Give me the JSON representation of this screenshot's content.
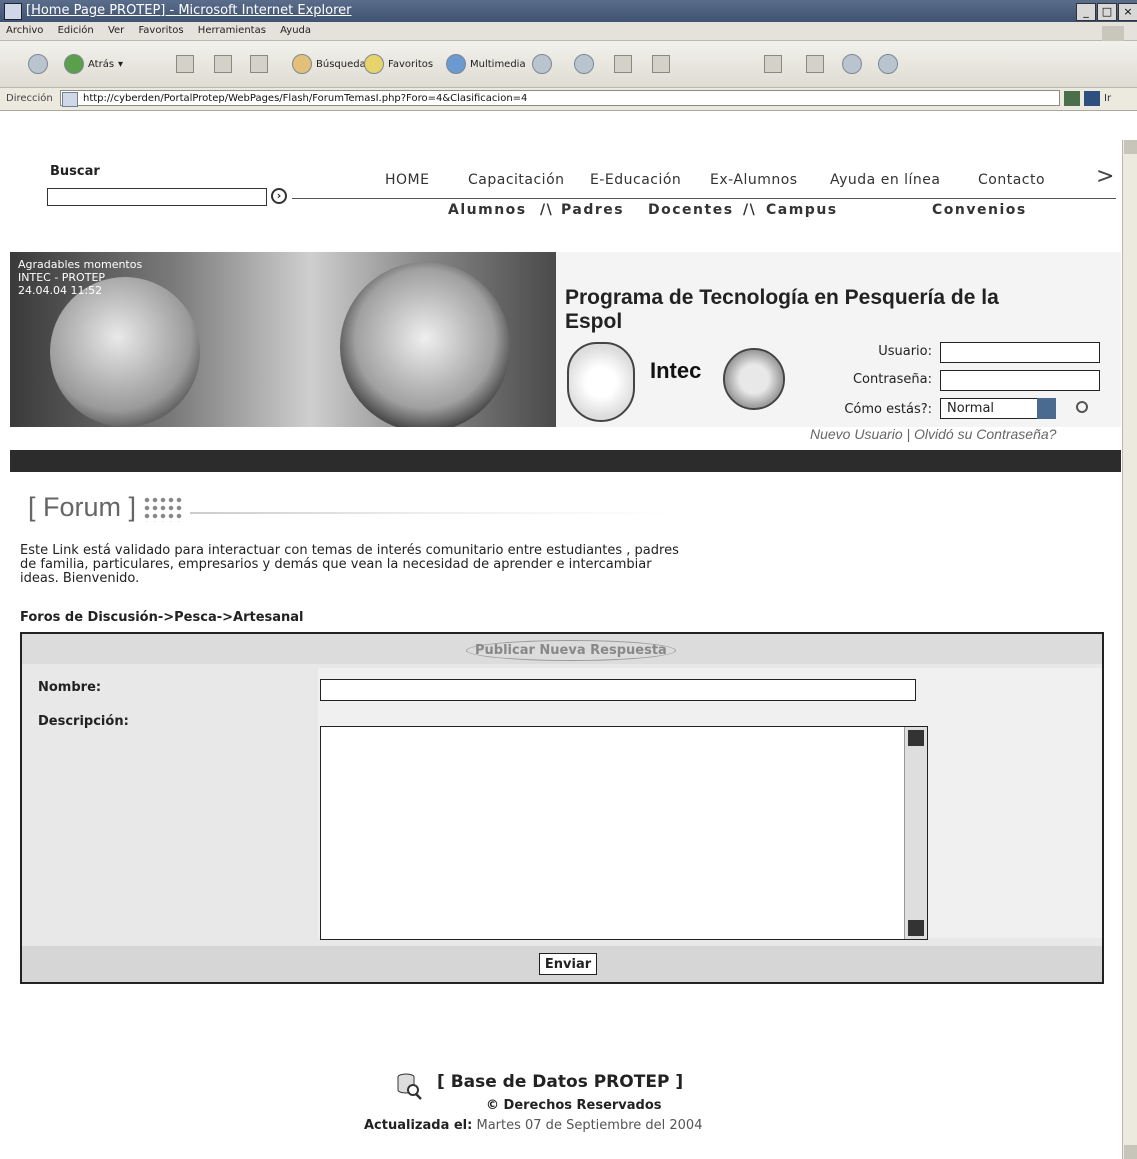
{
  "browser": {
    "window_title": "[Home Page PROTEP] - Microsoft Internet Explorer",
    "menu": [
      "Archivo",
      "Edición",
      "Ver",
      "Favoritos",
      "Herramientas",
      "Ayuda"
    ],
    "toolbar": {
      "back": "Atrás",
      "search": "Búsqueda",
      "favorites": "Favoritos",
      "multimedia": "Multimedia"
    },
    "address_label": "Dirección",
    "address_url": "http://cyberden/PortalProtep/WebPages/Flash/ForumTemasI.php?Foro=4&Clasificacion=4",
    "go_label": "Ir"
  },
  "header": {
    "search_label": "Buscar",
    "search_value": "",
    "nav_primary": [
      "HOME",
      "Capacitación",
      "E-Educación",
      "Ex-Alumnos",
      "Ayuda en línea",
      "Contacto"
    ],
    "nav_more": ">",
    "nav_secondary": [
      "Alumnos",
      "Padres",
      "Docentes",
      "Campus",
      "Convenios"
    ],
    "nav_separator": "/\\"
  },
  "banner": {
    "photo_caption": "Agradables momentos\nINTEC - PROTEP\n24.04.04  11:52",
    "program_title": "Programa de Tecnología en Pesquería de la Espol",
    "logo_text": "Intec",
    "login": {
      "user_label": "Usuario:",
      "password_label": "Contraseña:",
      "status_label": "Cómo estás?:",
      "status_value": "Normal",
      "new_user": "Nuevo Usuario",
      "link_separator": "|",
      "forgot_password": "Olvidó su Contraseña?"
    }
  },
  "forum": {
    "title": "[ Forum ]",
    "intro": "Este Link está validado para interactuar con temas de interés comunitario entre estudiantes , padres de familia, particulares, empresarios y demás que vean la necesidad de aprender e intercambiar ideas. Bienvenido.",
    "breadcrumb": "Foros de Discusión->Pesca->Artesanal"
  },
  "form": {
    "heading": "Publicar Nueva Respuesta",
    "name_label": "Nombre:",
    "name_value": "",
    "description_label": "Descripción:",
    "description_value": "",
    "submit_label": "Enviar"
  },
  "footer": {
    "db_title": "[ Base de Datos PROTEP ]",
    "rights": "© Derechos Reservados",
    "updated_label": "Actualizada el:",
    "updated_date": "Martes 07 de Septiembre del 2004"
  }
}
